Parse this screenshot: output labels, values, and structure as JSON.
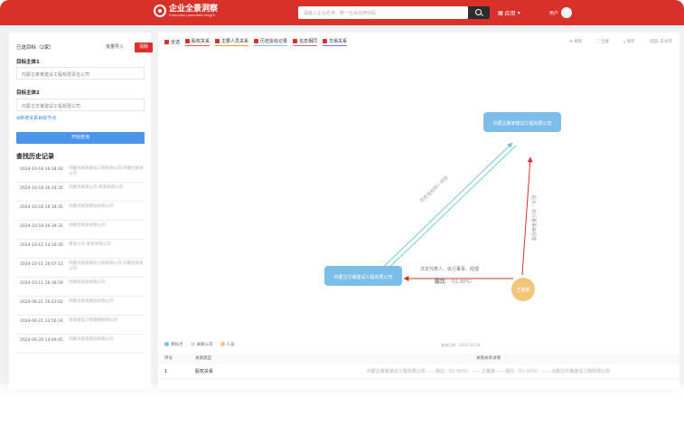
{
  "brand": {
    "name": "企业全景洞察",
    "tagline": "Enterprise panoramic insight"
  },
  "header": {
    "search_placeholder": "请输入企业名称、统一社会信用代码",
    "apps_label": "应用",
    "user_name": "用户"
  },
  "left": {
    "selected_title": "已选目标（2家）",
    "import_label": "批量导入",
    "clear_label": "清除",
    "target1_label": "目标主体1",
    "target1_value": "内蒙古某某建设工程有限责任公司",
    "target2_label": "目标主体2",
    "target2_value": "内蒙古华某建设工程有限公司",
    "add_link": "⊕新增关系目标节点",
    "query_button": "开始查询",
    "history_title": "查找历史记录",
    "history": [
      {
        "time": "2024-10-18 16:34:42",
        "name": "内蒙古某某建设工程有限公司-内蒙古某某公司"
      },
      {
        "time": "2024-10-18 16:34:35",
        "name": "内蒙古某某公司-某某有限公司"
      },
      {
        "time": "2024-10-18 16:34:35",
        "name": "内蒙古某某建设有限公司"
      },
      {
        "time": "2024-10-18 16:34:31",
        "name": "内蒙古某某有限公司"
      },
      {
        "time": "2024-10-12 14:18:26",
        "name": "某某公司-某某有限公司"
      },
      {
        "time": "2024-10-11 16:07:13",
        "name": "内蒙古某某建设工程有限公司-内蒙古某某公司"
      },
      {
        "time": "2024-10-11 16:38:59",
        "name": "内蒙古某某有限公司"
      },
      {
        "time": "2024-06-21 16:03:02",
        "name": "内蒙古某某建设有限公司"
      },
      {
        "time": "2024-06-21 13:56:24",
        "name": "某某建设工程管理有限公司"
      },
      {
        "time": "2024-06-20 14:09:45",
        "name": "内蒙古某某建设有限公司"
      }
    ]
  },
  "filters": [
    {
      "label": "全选",
      "color": "#d8312a"
    },
    {
      "label": "股权关系",
      "color": "#e05a52"
    },
    {
      "label": "主要人员关系",
      "color": "#e59a3a"
    },
    {
      "label": "历史投标记录",
      "color": "#7cc4d8"
    },
    {
      "label": "信息相同",
      "color": "#c86b9a"
    },
    {
      "label": "交易关系",
      "color": "#8a6fd8"
    }
  ],
  "tools": {
    "refresh": "刷新",
    "fullscreen": "全屏",
    "save": "保存",
    "toggle_label": "去水印"
  },
  "graph": {
    "node_top": "内蒙古某某建设工程有限公司",
    "node_left": "内蒙古华某建设工程有限公司",
    "node_person": "王某某",
    "edge_person_left": "股比",
    "edge_person_left_value": "（51.00%）",
    "edge_person_left_note": "法定代表人、执行董事、经理",
    "edge_top_left": "历史投标同一项目",
    "edge_person_top": "股东、执行董事兼经理"
  },
  "legend": [
    {
      "label": "目标点",
      "color": "#7dbde9"
    },
    {
      "label": "关联公司",
      "color": "#dddddd"
    },
    {
      "label": "人员",
      "color": "#f2c67a"
    }
  ],
  "date_hint": "查询日期：2024-10-18",
  "table": {
    "headers": [
      "序号",
      "关联类型",
      "关联关系详情"
    ],
    "rows": [
      {
        "index": "1",
        "type": "股权关系",
        "detail": "内蒙古某某建设工程有限公司 ——股比（51.00%）—— 王某某 ——股比（51.00%）—— 内蒙古华某建设工程有限公司"
      }
    ]
  }
}
